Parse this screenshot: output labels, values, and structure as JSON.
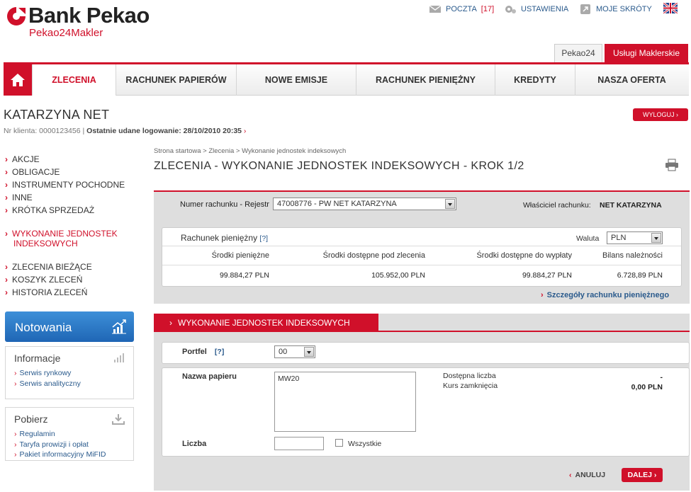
{
  "header": {
    "logo_main": "Bank Pekao",
    "logo_sub": "Pekao24Makler",
    "mail_label": "POCZTA",
    "mail_count": "[17]",
    "settings_label": "USTAWIENIA",
    "shortcuts_label": "MOJE SKRÓTY",
    "tab_pekao24": "Pekao24",
    "tab_uslugi": "Usługi Maklerskie"
  },
  "nav": {
    "items": [
      "ZLECENIA",
      "RACHUNEK PAPIERÓW",
      "NOWE EMISJE",
      "RACHUNEK PIENIĘŻNY",
      "KREDYTY",
      "NASZA OFERTA"
    ]
  },
  "user": {
    "name": "KATARZYNA NET",
    "client_label": "Nr klienta: 0000123456",
    "last_login": "Ostatnie udane logowanie: 28/10/2010 20:35",
    "logout": "WYLOGUJ"
  },
  "left_menu": {
    "group1": [
      "AKCJE",
      "OBLIGACJE",
      "INSTRUMENTY POCHODNE",
      "INNE",
      "KRÓTKA SPRZEDAŻ"
    ],
    "active_line1": "WYKONANIE JEDNOSTEK",
    "active_line2": "INDEKSOWYCH",
    "group2": [
      "ZLECENIA BIEŻĄCE",
      "KOSZYK ZLECEŃ",
      "HISTORIA ZLECEŃ"
    ],
    "notowania": "Notowania",
    "info_title": "Informacje",
    "info_links": [
      "Serwis rynkowy",
      "Serwis analityczny"
    ],
    "pobierz_title": "Pobierz",
    "pobierz_links": [
      "Regulamin",
      "Taryfa prowizji i opłat",
      "Pakiet informacyjny MiFID"
    ]
  },
  "main": {
    "breadcrumb": "Strona startowa > Zlecenia > Wykonanie jednostek indeksowych",
    "title": "ZLECENIA - WYKONANIE JEDNOSTEK INDEKSOWYCH - KROK 1/2",
    "account_label": "Numer rachunku - Rejestr",
    "account_value": "47008776 - PW NET KATARZYNA",
    "owner_label": "Właściciel rachunku:",
    "owner_value": "NET KATARZYNA",
    "cash_title": "Rachunek pieniężny",
    "help": "[?]",
    "currency_label": "Waluta",
    "currency_value": "PLN",
    "cols": [
      "Środki pieniężne",
      "Środki dostępne pod zlecenia",
      "Środki dostępne do wypłaty",
      "Bilans należności"
    ],
    "vals": [
      "99.884,27  PLN",
      "105.952,00  PLN",
      "99.884,27  PLN",
      "6.728,89  PLN"
    ],
    "details_link": "Szczegóły rachunku pieniężnego",
    "section_title": "WYKONANIE JEDNOSTEK INDEKSOWYCH",
    "portfel_label": "Portfel",
    "portfel_value": "00",
    "paper_label": "Nazwa papieru",
    "paper_value": "MW20",
    "avail_label": "Dostępna liczba",
    "avail_value": "-",
    "close_label": "Kurs zamknięcia",
    "close_value": "0,00 PLN",
    "qty_label": "Liczba",
    "all_label": "Wszystkie",
    "cancel": "ANULUJ",
    "next": "DALEJ"
  }
}
